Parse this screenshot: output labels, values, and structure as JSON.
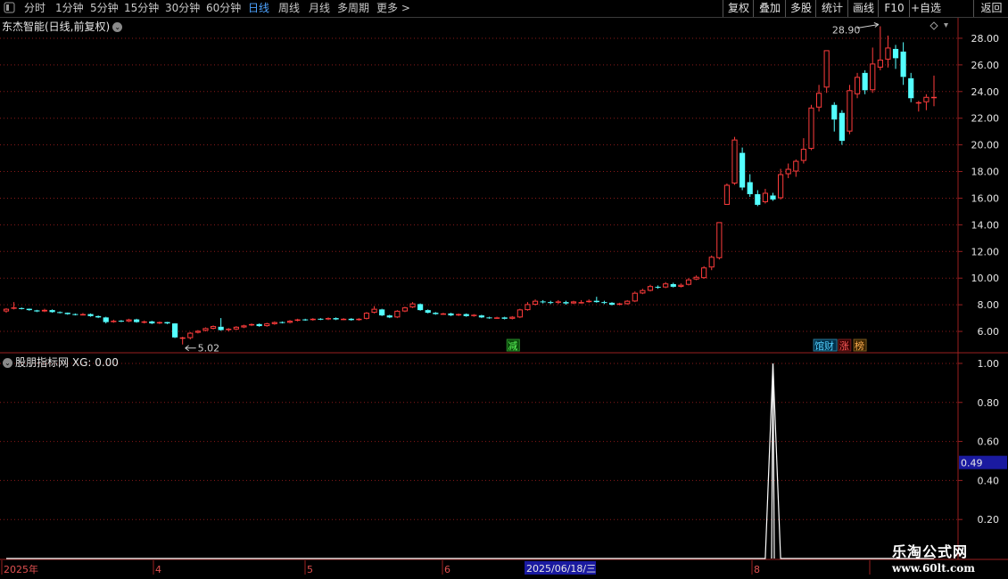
{
  "toolbar": {
    "periods": [
      "分时",
      "1分钟",
      "5分钟",
      "15分钟",
      "30分钟",
      "60分钟",
      "日线",
      "周线",
      "月线",
      "多周期",
      "更多 >"
    ],
    "active": "日线",
    "right_buttons": [
      "复权",
      "叠加",
      "多股",
      "统计",
      "画线",
      "F10",
      "+自选",
      "返回"
    ]
  },
  "stock": {
    "title": "东杰智能(日线,前复权)"
  },
  "indicator": {
    "title": "股朋指标网",
    "xg_label": "XG: 0.00",
    "current_value": "0.49"
  },
  "markers": {
    "high": "28.90",
    "low": "5.02",
    "tag_jian": "减",
    "tag_guancai": "馆财",
    "tag_zhang": "涨",
    "tag_bang": "榜"
  },
  "timeline": {
    "labels": [
      "2025年",
      "4",
      "5",
      "6",
      "8"
    ],
    "cursor_date": "2025/06/18/三"
  },
  "watermark": {
    "name": "乐淘公式网",
    "url": "www.60lt.com"
  },
  "colors": {
    "up": "#ff3c3c",
    "down": "#54ffff",
    "grid": "#8a1a1a",
    "axis_text": "#e6e6e6",
    "line": "#ffffff"
  },
  "chart_data": [
    {
      "type": "candlestick",
      "ylim": [
        4.6,
        29.4
      ],
      "yticks": [
        6,
        8,
        10,
        12,
        14,
        16,
        18,
        20,
        22,
        24,
        26,
        28
      ],
      "candles": [
        [
          7.5,
          7.7,
          7.4,
          7.75
        ],
        [
          7.7,
          7.8,
          7.65,
          8.2
        ],
        [
          7.75,
          7.7,
          7.65,
          7.8
        ],
        [
          7.7,
          7.6,
          7.55,
          7.72
        ],
        [
          7.58,
          7.5,
          7.45,
          7.62
        ],
        [
          7.5,
          7.62,
          7.45,
          7.7
        ],
        [
          7.6,
          7.45,
          7.4,
          7.65
        ],
        [
          7.45,
          7.4,
          7.35,
          7.5
        ],
        [
          7.4,
          7.3,
          7.25,
          7.42
        ],
        [
          7.3,
          7.25,
          7.2,
          7.35
        ],
        [
          7.25,
          7.3,
          7.2,
          7.38
        ],
        [
          7.3,
          7.15,
          7.1,
          7.35
        ],
        [
          7.15,
          7.05,
          7.0,
          7.2
        ],
        [
          7.05,
          6.7,
          6.6,
          7.1
        ],
        [
          6.7,
          6.8,
          6.65,
          6.88
        ],
        [
          6.8,
          6.75,
          6.7,
          6.85
        ],
        [
          6.75,
          6.9,
          6.7,
          6.95
        ],
        [
          6.9,
          6.7,
          6.65,
          6.95
        ],
        [
          6.7,
          6.75,
          6.6,
          6.82
        ],
        [
          6.75,
          6.6,
          6.55,
          6.8
        ],
        [
          6.6,
          6.7,
          6.55,
          6.75
        ],
        [
          6.7,
          6.6,
          6.55,
          6.72
        ],
        [
          6.6,
          5.55,
          5.5,
          6.62
        ],
        [
          5.55,
          5.55,
          5.02,
          5.6
        ],
        [
          5.5,
          5.9,
          5.4,
          5.95
        ],
        [
          5.9,
          6.05,
          5.85,
          6.1
        ],
        [
          6.05,
          6.25,
          6.0,
          6.3
        ],
        [
          6.2,
          6.4,
          6.15,
          6.45
        ],
        [
          6.35,
          6.1,
          6.05,
          7.0
        ],
        [
          6.1,
          6.2,
          6.0,
          6.25
        ],
        [
          6.15,
          6.35,
          6.1,
          6.4
        ],
        [
          6.3,
          6.45,
          6.25,
          6.5
        ],
        [
          6.45,
          6.55,
          6.4,
          6.6
        ],
        [
          6.55,
          6.4,
          6.35,
          6.6
        ],
        [
          6.4,
          6.6,
          6.35,
          6.65
        ],
        [
          6.55,
          6.7,
          6.5,
          6.75
        ],
        [
          6.7,
          6.65,
          6.6,
          6.75
        ],
        [
          6.65,
          6.8,
          6.6,
          6.85
        ],
        [
          6.8,
          6.9,
          6.75,
          6.95
        ],
        [
          6.9,
          6.85,
          6.8,
          6.95
        ],
        [
          6.85,
          6.95,
          6.8,
          7.0
        ],
        [
          6.95,
          6.9,
          6.85,
          7.0
        ],
        [
          6.9,
          7.0,
          6.85,
          7.05
        ],
        [
          7.0,
          6.9,
          6.85,
          7.05
        ],
        [
          6.9,
          6.95,
          6.85,
          7.0
        ],
        [
          6.95,
          6.85,
          6.8,
          7.0
        ],
        [
          6.85,
          6.95,
          6.8,
          7.0
        ],
        [
          6.95,
          7.4,
          6.9,
          7.45
        ],
        [
          7.4,
          7.7,
          7.35,
          7.9
        ],
        [
          7.65,
          7.2,
          7.15,
          7.7
        ],
        [
          7.2,
          7.05,
          7.0,
          7.25
        ],
        [
          7.05,
          7.55,
          7.0,
          7.6
        ],
        [
          7.5,
          7.8,
          7.45,
          7.85
        ],
        [
          7.8,
          8.1,
          7.75,
          8.2
        ],
        [
          8.05,
          7.6,
          7.55,
          8.1
        ],
        [
          7.6,
          7.4,
          7.35,
          7.65
        ],
        [
          7.4,
          7.3,
          7.25,
          7.45
        ],
        [
          7.3,
          7.35,
          7.25,
          7.4
        ],
        [
          7.35,
          7.2,
          7.15,
          7.4
        ],
        [
          7.2,
          7.3,
          7.15,
          7.35
        ],
        [
          7.3,
          7.15,
          7.1,
          7.35
        ],
        [
          7.15,
          7.25,
          7.1,
          7.3
        ],
        [
          7.2,
          7.05,
          7.0,
          7.25
        ],
        [
          7.05,
          7.0,
          6.95,
          7.1
        ],
        [
          7.0,
          7.05,
          6.95,
          7.1
        ],
        [
          7.05,
          6.95,
          6.9,
          7.1
        ],
        [
          6.95,
          7.1,
          6.9,
          7.15
        ],
        [
          7.05,
          7.65,
          7.0,
          7.7
        ],
        [
          7.6,
          8.05,
          7.55,
          8.2
        ],
        [
          8.0,
          8.3,
          7.95,
          8.4
        ],
        [
          8.25,
          8.2,
          8.1,
          8.35
        ],
        [
          8.2,
          8.15,
          8.05,
          8.3
        ],
        [
          8.15,
          8.25,
          8.05,
          8.35
        ],
        [
          8.2,
          8.1,
          8.0,
          8.3
        ],
        [
          8.1,
          8.25,
          8.05,
          8.3
        ],
        [
          8.2,
          8.2,
          8.1,
          8.35
        ],
        [
          8.2,
          8.3,
          8.15,
          8.4
        ],
        [
          8.3,
          8.2,
          8.15,
          8.6
        ],
        [
          8.2,
          8.15,
          8.05,
          8.3
        ],
        [
          8.15,
          8.0,
          7.95,
          8.2
        ],
        [
          8.0,
          8.1,
          7.95,
          8.15
        ],
        [
          8.05,
          8.3,
          8.0,
          8.35
        ],
        [
          8.25,
          8.9,
          8.2,
          9.0
        ],
        [
          8.85,
          9.1,
          8.8,
          9.2
        ],
        [
          9.05,
          9.4,
          9.0,
          9.5
        ],
        [
          9.35,
          9.3,
          9.2,
          9.45
        ],
        [
          9.3,
          9.6,
          9.25,
          9.7
        ],
        [
          9.55,
          9.35,
          9.3,
          9.65
        ],
        [
          9.35,
          9.5,
          9.3,
          9.6
        ],
        [
          9.5,
          9.9,
          9.45,
          10.0
        ],
        [
          9.9,
          10.1,
          9.85,
          10.2
        ],
        [
          10.0,
          10.8,
          9.95,
          10.9
        ],
        [
          10.8,
          11.6,
          10.6,
          11.7
        ],
        [
          11.5,
          14.2,
          11.4,
          14.2
        ],
        [
          15.5,
          17.0,
          15.5,
          17.1
        ],
        [
          17.1,
          20.4,
          17.0,
          20.6
        ],
        [
          19.4,
          16.8,
          16.6,
          19.8
        ],
        [
          17.2,
          16.3,
          16.1,
          17.8
        ],
        [
          16.3,
          15.5,
          15.4,
          16.6
        ],
        [
          15.7,
          16.4,
          15.6,
          16.7
        ],
        [
          16.2,
          15.9,
          15.8,
          16.4
        ],
        [
          16.0,
          17.8,
          15.9,
          18.2
        ],
        [
          17.8,
          18.2,
          17.5,
          18.6
        ],
        [
          18.0,
          18.8,
          17.6,
          18.9
        ],
        [
          18.8,
          19.7,
          18.6,
          20.5
        ],
        [
          19.7,
          22.8,
          19.6,
          23.0
        ],
        [
          22.8,
          23.9,
          22.5,
          24.5
        ],
        [
          24.3,
          27.1,
          23.9,
          27.1
        ],
        [
          23.0,
          21.9,
          21.0,
          23.2
        ],
        [
          22.4,
          20.3,
          20.0,
          22.6
        ],
        [
          21.0,
          24.1,
          20.8,
          24.5
        ],
        [
          23.8,
          25.1,
          23.5,
          25.4
        ],
        [
          25.4,
          24.1,
          23.8,
          25.6
        ],
        [
          24.1,
          26.1,
          23.9,
          27.3
        ],
        [
          25.8,
          26.4,
          25.6,
          28.9
        ],
        [
          26.4,
          27.3,
          25.8,
          28.2
        ],
        [
          27.2,
          26.5,
          25.7,
          27.5
        ],
        [
          27.0,
          25.1,
          24.5,
          27.7
        ],
        [
          25.0,
          23.5,
          23.2,
          25.4
        ],
        [
          23.2,
          23.2,
          22.5,
          23.3
        ],
        [
          23.2,
          23.6,
          22.6,
          23.8
        ],
        [
          23.5,
          23.6,
          22.9,
          25.2
        ]
      ]
    },
    {
      "type": "line",
      "name": "XG",
      "ylim": [
        0,
        1.05
      ],
      "yticks": [
        0.2,
        0.4,
        0.6,
        0.8,
        1.0
      ],
      "values": [
        0,
        0,
        0,
        0,
        0,
        0,
        0,
        0,
        0,
        0,
        0,
        0,
        0,
        0,
        0,
        0,
        0,
        0,
        0,
        0,
        0,
        0,
        0,
        0,
        0,
        0,
        0,
        0,
        0,
        0,
        0,
        0,
        0,
        0,
        0,
        0,
        0,
        0,
        0,
        0,
        0,
        0,
        0,
        0,
        0,
        0,
        0,
        0,
        0,
        0,
        0,
        0,
        0,
        0,
        0,
        0,
        0,
        0,
        0,
        0,
        0,
        0,
        0,
        0,
        0,
        0,
        0,
        0,
        0,
        0,
        0,
        0,
        0,
        0,
        0,
        0,
        0,
        0,
        0,
        0,
        0,
        0,
        0,
        0,
        0,
        0,
        0,
        0,
        0,
        0,
        0,
        0,
        0,
        0,
        0,
        0,
        0,
        0,
        0,
        0,
        1,
        0,
        0,
        0,
        0,
        0,
        0,
        0,
        0,
        0,
        0,
        0,
        0,
        0,
        0,
        0,
        0,
        0,
        0,
        0,
        0,
        0
      ]
    }
  ]
}
